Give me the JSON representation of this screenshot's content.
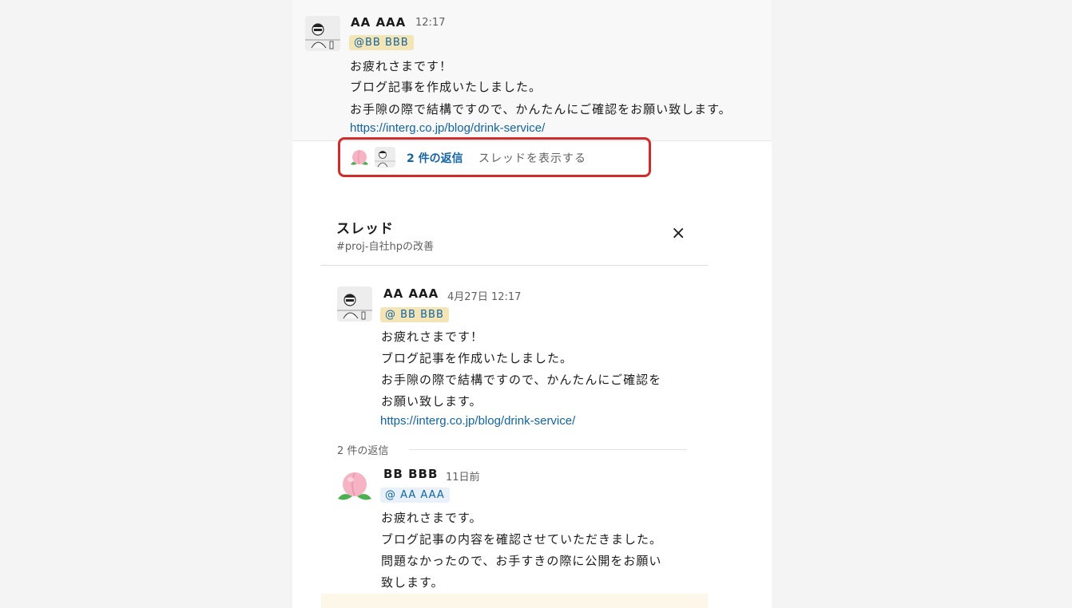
{
  "message": {
    "author": "AA AAA",
    "time": "12:17",
    "mention": "@BB BBB",
    "lines": [
      "お疲れさまです！",
      "ブログ記事を作成いたしました。",
      "お手隙の際で結構ですので、かんたんにご確認をお願い致します。"
    ],
    "link": "https://interg.co.jp/blog/drink-service/"
  },
  "thread_bar": {
    "reply_count": "2 件の返信",
    "view_thread": "スレッドを表示する"
  },
  "thread_panel": {
    "title": "スレッド",
    "channel": "#proj-自社hpの改善",
    "close_icon": "×",
    "parent": {
      "author": "AA AAA",
      "time": "4月27日 12:17",
      "mention": "@ BB BBB",
      "lines": [
        "お疲れさまです！",
        "ブログ記事を作成いたしました。",
        "お手隙の際で結構ですので、かんたんにご確認を",
        "お願い致します。"
      ],
      "link": "https://interg.co.jp/blog/drink-service/"
    },
    "replies_label": "2 件の返信",
    "reply": {
      "author": "BB BBB",
      "time": "11日前",
      "mention": "@ AA AAA",
      "lines": [
        "お疲れさまです。",
        "ブログ記事の内容を確認させていただきました。",
        "問題なかったので、お手すきの際に公開をお願い",
        "致します。"
      ]
    }
  },
  "colors": {
    "accent_red": "#d12b2b",
    "link_blue": "#1264a3",
    "mention_bg": "#f3e5b6",
    "mention_bg_blue": "#e8f1f9"
  },
  "icons": {
    "avatar_aa": "person-sketch-avatar",
    "avatar_bb": "peach-avatar",
    "close": "close-icon",
    "arrow": "arrow-down-icon"
  }
}
